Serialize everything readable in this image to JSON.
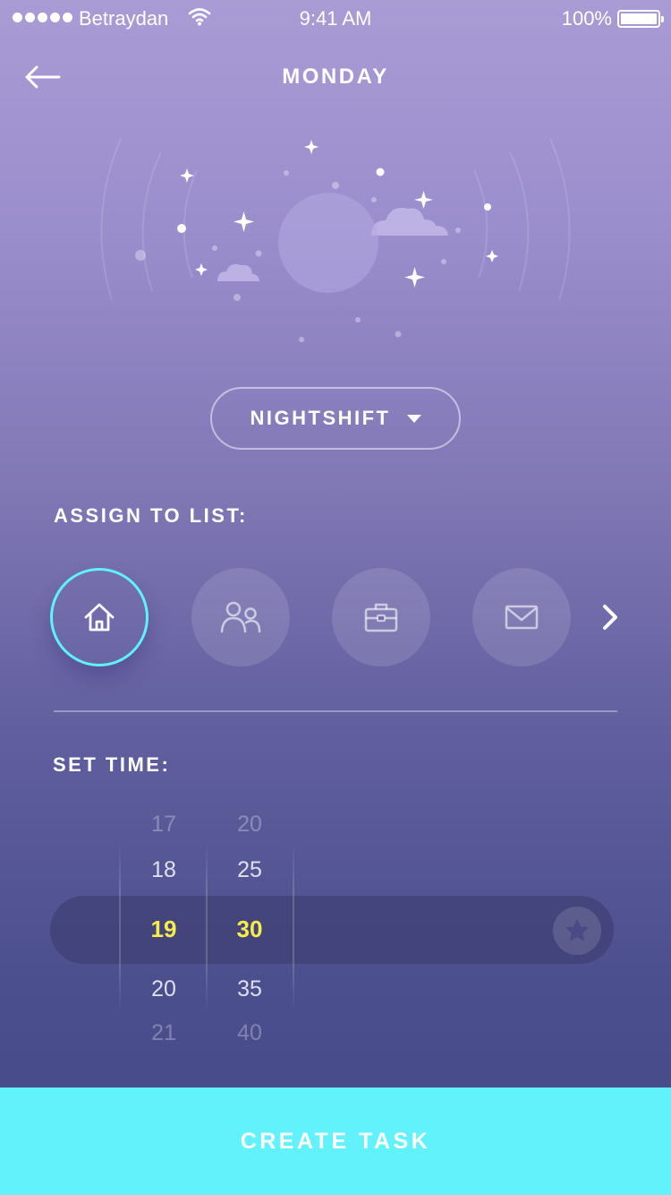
{
  "status_bar": {
    "carrier": "Betraydan",
    "time": "9:41 AM",
    "battery": "100%"
  },
  "header": {
    "title": "MONDAY"
  },
  "shift_selector": {
    "value": "NIGHTSHIFT"
  },
  "assign": {
    "label": "ASSIGN TO LIST:",
    "lists": [
      {
        "icon": "home-icon",
        "selected": true
      },
      {
        "icon": "people-icon",
        "selected": false
      },
      {
        "icon": "briefcase-icon",
        "selected": false
      },
      {
        "icon": "mail-icon",
        "selected": false
      }
    ]
  },
  "time": {
    "label": "SET TIME:",
    "hours": [
      "17",
      "18",
      "19",
      "20",
      "21"
    ],
    "minutes": [
      "20",
      "25",
      "30",
      "35",
      "40"
    ],
    "selected_hour": "19",
    "selected_minute": "30"
  },
  "actions": {
    "create_label": "CREATE TASK"
  },
  "colors": {
    "accent": "#62f2fb",
    "selected_time": "#f7ec4a",
    "moon": "#f9ed4b"
  }
}
